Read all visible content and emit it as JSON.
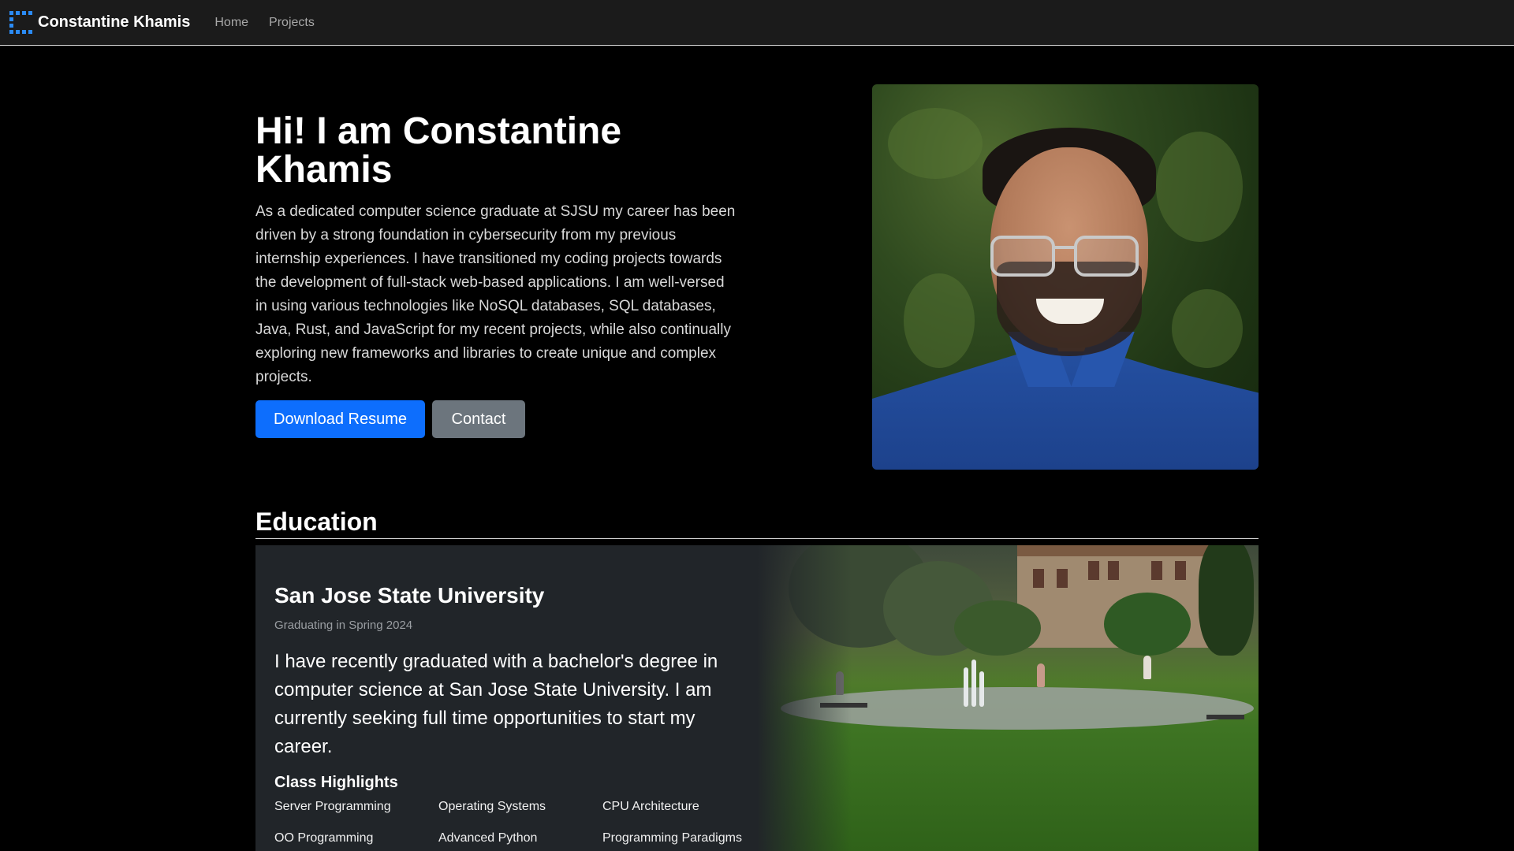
{
  "navbar": {
    "brand": "Constantine Khamis",
    "links": [
      "Home",
      "Projects"
    ]
  },
  "hero": {
    "title": "Hi! I am Constantine Khamis",
    "description": "As a dedicated computer science graduate at SJSU my career has been driven by a strong foundation in cybersecurity from my previous internship experiences. I have transitioned my coding projects towards the development of full-stack web-based applications. I am well-versed in using various technologies like NoSQL databases, SQL databases, Java, Rust, and JavaScript for my recent projects, while also continually exploring new frameworks and libraries to create unique and complex projects.",
    "buttons": {
      "resume": "Download Resume",
      "contact": "Contact"
    }
  },
  "education": {
    "title": "Education",
    "school": "San Jose State University",
    "subtitle": "Graduating in Spring 2024",
    "description": "I have recently graduated with a bachelor's degree in computer science at San Jose State University. I am currently seeking full time opportunities to start my career.",
    "highlights_title": "Class Highlights",
    "classes": [
      "Server Programming",
      "Operating Systems",
      "CPU Architecture",
      "OO Programming",
      "Advanced Python",
      "Programming Paradigms"
    ]
  },
  "colors": {
    "primary_button": "#0d6efd",
    "secondary_button": "#6c757d",
    "card_bg": "#212529",
    "logo": "#2b8bf5"
  }
}
